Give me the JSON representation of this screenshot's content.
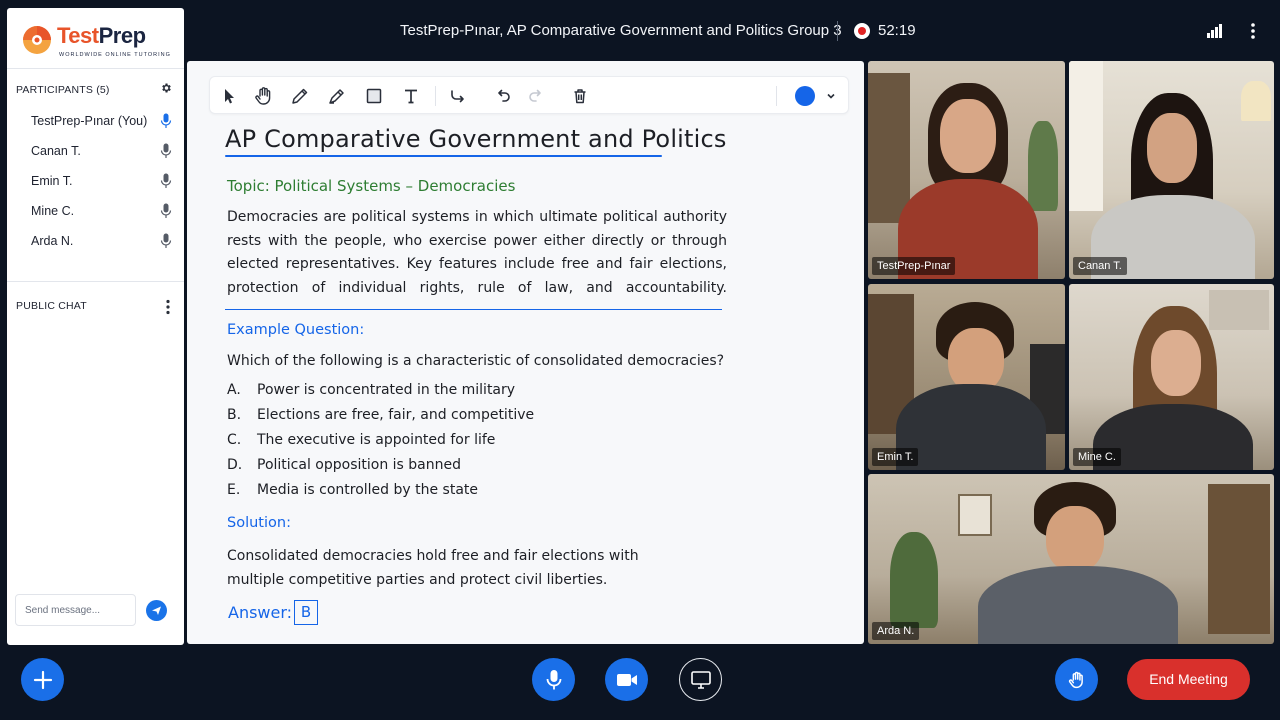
{
  "header": {
    "meeting_title": "TestPrep-Pınar, AP Comparative Government and Politics Group 3",
    "recording_time": "52:19"
  },
  "brand": {
    "logo_text_1": "Test",
    "logo_text_2": "Prep",
    "tagline": "WORLDWIDE ONLINE TUTORING"
  },
  "sidebar": {
    "participants_heading": "PARTICIPANTS (5)",
    "participants": [
      {
        "name": "TestPrep-Pınar (You)",
        "mic": "active"
      },
      {
        "name": "Canan T.",
        "mic": "idle"
      },
      {
        "name": "Emin T.",
        "mic": "idle"
      },
      {
        "name": "Mine C.",
        "mic": "idle"
      },
      {
        "name": "Arda N.",
        "mic": "idle"
      }
    ],
    "chat_heading": "PUBLIC CHAT",
    "chat_placeholder": "Send message..."
  },
  "toolbar": {
    "tools": [
      "select-icon",
      "pan-hand-icon",
      "pencil-icon",
      "highlighter-icon",
      "shape-rectangle-icon",
      "text-icon",
      "connector-icon",
      "undo-icon",
      "redo-icon",
      "delete-icon"
    ],
    "active_color": "#1565e8"
  },
  "whiteboard": {
    "title": "AP Comparative Government and Politics",
    "topic": "Topic: Political Systems – Democracies",
    "paragraph": "Democracies are political systems in which ultimate political authority rests with the people, who exercise power either directly or through elected representatives. Key features include free and fair elections, protection of individual rights, rule of law, and accountability.",
    "example_heading": "Example Question:",
    "question": "Which of the following is a characteristic of consolidated democracies?",
    "options": [
      {
        "letter": "A.",
        "text": "Power is concentrated in the military"
      },
      {
        "letter": "B.",
        "text": "Elections are free, fair, and competitive"
      },
      {
        "letter": "C.",
        "text": "The executive is appointed for life"
      },
      {
        "letter": "D.",
        "text": "Political opposition is banned"
      },
      {
        "letter": "E.",
        "text": "Media is controlled by the state"
      }
    ],
    "solution_heading": "Solution:",
    "solution": "Consolidated democracies hold free and fair elections with multiple competitive parties and protect civil liberties.",
    "answer_label": "Answer:",
    "answer_value": "B"
  },
  "videos": [
    {
      "name": "TestPrep-Pınar"
    },
    {
      "name": "Canan T."
    },
    {
      "name": "Emin T."
    },
    {
      "name": "Mine C."
    },
    {
      "name": "Arda N."
    }
  ],
  "controls": {
    "end_meeting": "End Meeting"
  },
  "colors": {
    "background": "#0c1422",
    "accent": "#1a6fe8",
    "end_button": "#d9302c",
    "topic_green": "#2e7d32"
  }
}
